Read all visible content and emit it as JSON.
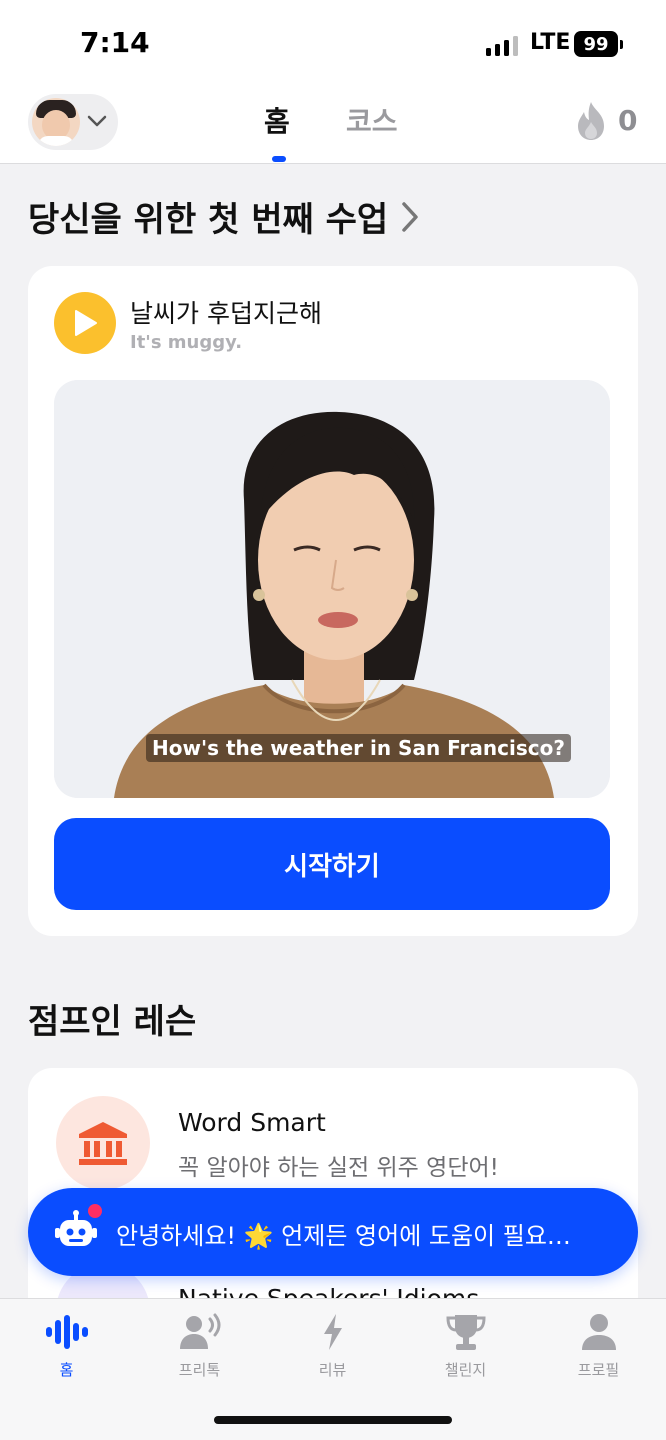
{
  "status_bar": {
    "time": "7:14",
    "network": "LTE",
    "battery": "99"
  },
  "header": {
    "tabs": [
      {
        "label": "홈",
        "active": true
      },
      {
        "label": "코스",
        "active": false
      }
    ],
    "streak_count": "0"
  },
  "first_lesson": {
    "section_title": "당신을 위한 첫 번째 수업",
    "title": "날씨가 후덥지근해",
    "subtitle": "It's muggy.",
    "video_caption": "How's the weather in San Francisco?",
    "start_label": "시작하기"
  },
  "jumpin": {
    "section_title": "점프인 레슨",
    "courses": [
      {
        "title": "Word Smart",
        "subtitle": "꼭 알아야 하는 실전 위주 영단어!",
        "icon": "bank-icon"
      },
      {
        "title": "Native Speakers' Idioms",
        "icon": "idioms-icon"
      }
    ]
  },
  "chat_banner": {
    "text": "안녕하세요! 🌟 언제든 영어에 도움이 필요…"
  },
  "tab_bar": {
    "items": [
      {
        "label": "홈",
        "icon": "voice-wave-icon",
        "active": true
      },
      {
        "label": "프리톡",
        "icon": "speaking-person-icon",
        "active": false
      },
      {
        "label": "리뷰",
        "icon": "lightning-icon",
        "active": false
      },
      {
        "label": "챌린지",
        "icon": "trophy-icon",
        "active": false
      },
      {
        "label": "프로필",
        "icon": "person-icon",
        "active": false
      }
    ]
  },
  "colors": {
    "accent": "#0a4dff",
    "play": "#fbc02d",
    "badge": "#ff2e63"
  }
}
